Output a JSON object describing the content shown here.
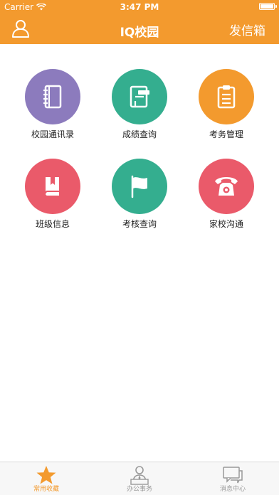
{
  "status_bar": {
    "carrier": "Carrier",
    "time": "3:47 PM"
  },
  "navbar": {
    "title": "IQ校园",
    "right_action": "发信箱"
  },
  "colors": {
    "brand_orange": "#f39a2e",
    "purple": "#8c7bbd",
    "teal": "#34ae8f",
    "orange": "#f39a2e",
    "red": "#ea5a6a"
  },
  "grid": [
    {
      "label": "校园通讯录",
      "icon": "address-book-icon",
      "color": "#8c7bbd"
    },
    {
      "label": "成绩查询",
      "icon": "grades-icon",
      "color": "#34ae8f"
    },
    {
      "label": "考务管理",
      "icon": "clipboard-icon",
      "color": "#f39a2e"
    },
    {
      "label": "班级信息",
      "icon": "class-book-icon",
      "color": "#ea5a6a"
    },
    {
      "label": "考核查询",
      "icon": "flag-icon",
      "color": "#34ae8f"
    },
    {
      "label": "家校沟通",
      "icon": "telephone-icon",
      "color": "#ea5a6a"
    }
  ],
  "tabbar": [
    {
      "label": "常用收藏",
      "icon": "star-icon",
      "active": true
    },
    {
      "label": "办公事务",
      "icon": "office-person-icon",
      "active": false
    },
    {
      "label": "消息中心",
      "icon": "chat-bubbles-icon",
      "active": false
    }
  ]
}
